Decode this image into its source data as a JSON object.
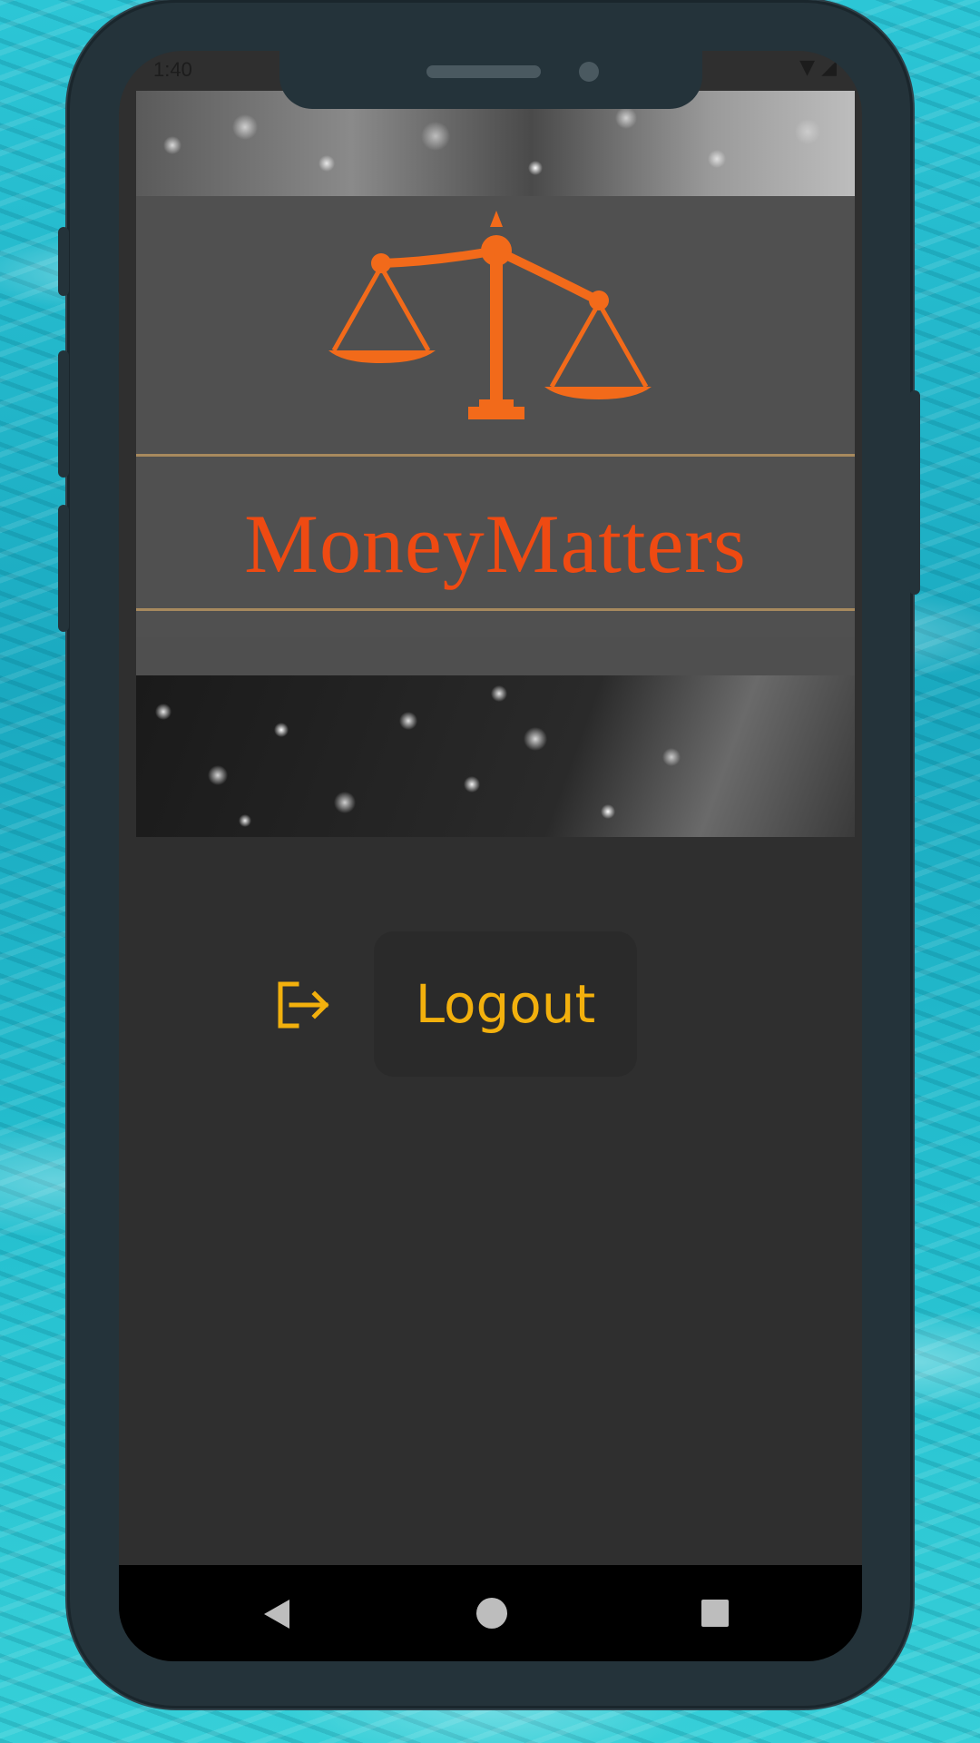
{
  "status_bar": {
    "time": "1:40"
  },
  "banner": {
    "brand_name": "MoneyMatters",
    "brand_color": "#ef4a12",
    "accent_line_color": "#a88a5e"
  },
  "main": {
    "logout_label": "Logout",
    "logout_color": "#f2b00d"
  },
  "icons": {
    "logo": "scales-of-justice-icon",
    "logout": "logout-icon",
    "nav_back": "back-triangle-icon",
    "nav_home": "home-circle-icon",
    "nav_recent": "recents-square-icon"
  }
}
